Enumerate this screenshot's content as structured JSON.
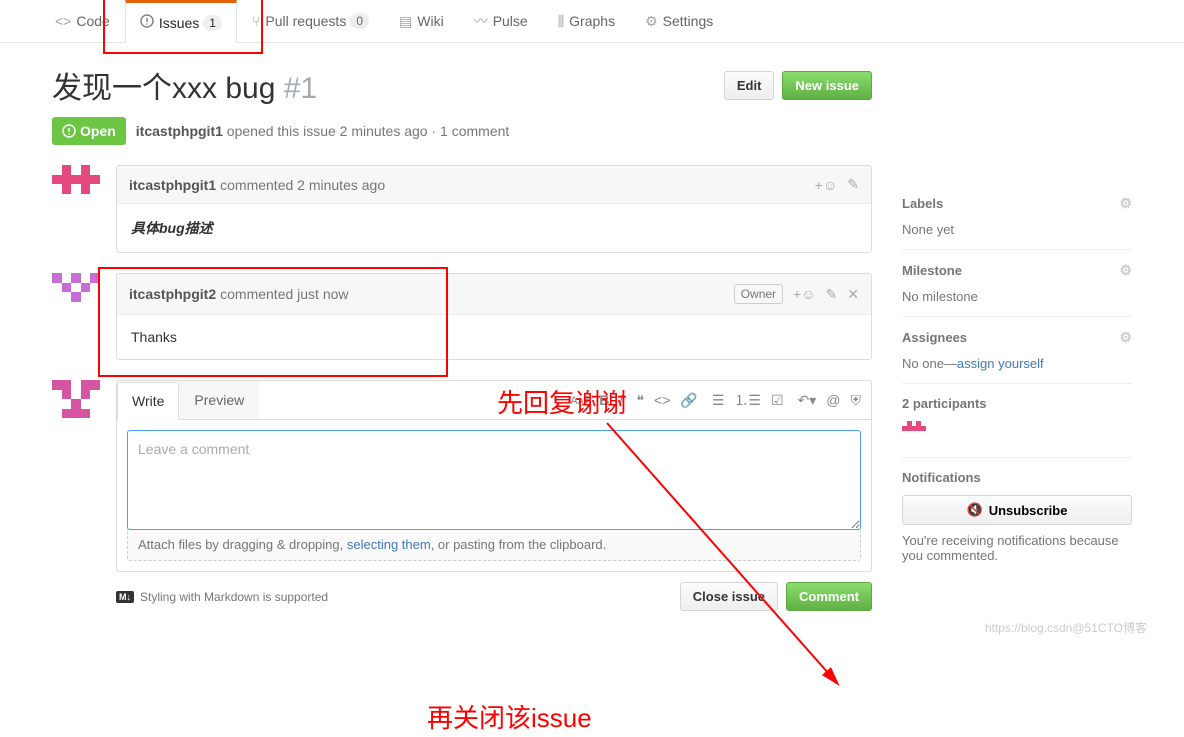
{
  "nav": {
    "code": "Code",
    "issues": "Issues",
    "issues_count": "1",
    "pulls": "Pull requests",
    "pulls_count": "0",
    "wiki": "Wiki",
    "pulse": "Pulse",
    "graphs": "Graphs",
    "settings": "Settings"
  },
  "issue": {
    "title": "发现一个xxx bug",
    "number": "#1",
    "edit_btn": "Edit",
    "new_issue_btn": "New issue",
    "state": "Open",
    "opener": "itcastphpgit1",
    "meta_rest": " opened this issue 2 minutes ago · 1 comment"
  },
  "comments": [
    {
      "author": "itcastphpgit1",
      "time": " commented 2 minutes ago",
      "body": "具体bug描述",
      "owner": false
    },
    {
      "author": "itcastphpgit2",
      "time": " commented just now",
      "body": "Thanks",
      "owner": true,
      "owner_label": "Owner"
    }
  ],
  "editor": {
    "write_tab": "Write",
    "preview_tab": "Preview",
    "placeholder": "Leave a comment",
    "attach_prefix": "Attach files by dragging & dropping, ",
    "attach_link": "selecting them",
    "attach_suffix": ", or pasting from the clipboard.",
    "markdown_note": "Styling with Markdown is supported",
    "close_btn": "Close issue",
    "comment_btn": "Comment"
  },
  "sidebar": {
    "labels_heading": "Labels",
    "labels_none": "None yet",
    "milestone_heading": "Milestone",
    "milestone_none": "No milestone",
    "assignees_heading": "Assignees",
    "assignees_none_prefix": "No one—",
    "assignees_link": "assign yourself",
    "participants_heading": "2 participants",
    "notifications_heading": "Notifications",
    "unsubscribe_btn": "Unsubscribe",
    "notifications_reason": "You're receiving notifications because you commented."
  },
  "annotations": {
    "reply_first": "先回复谢谢",
    "then_close": "再关闭该issue"
  },
  "watermark": "https://blog.csdn@51CTO博客"
}
